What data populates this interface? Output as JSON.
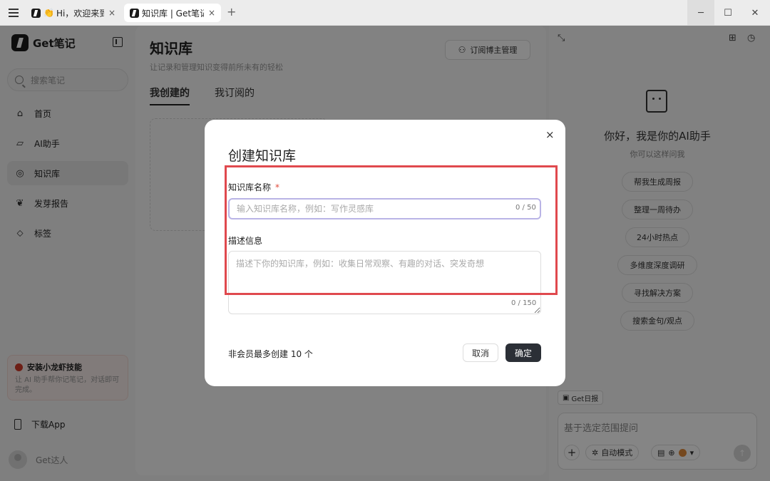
{
  "tabs": [
    {
      "emoji": "👏",
      "title": "Hi，欢迎来到Get笔记",
      "close": "×"
    },
    {
      "title": "知识库 | Get笔记",
      "close": "×"
    }
  ],
  "new_tab": "+",
  "window": {
    "minimize": "─",
    "maximize": "☐",
    "close": "✕"
  },
  "sidebar": {
    "logo_text": "Get笔记",
    "search_placeholder": "搜索笔记",
    "items": [
      {
        "icon": "⌂",
        "label": "首页"
      },
      {
        "icon": "▱",
        "label": "AI助手"
      },
      {
        "icon": "◎",
        "label": "知识库"
      },
      {
        "icon": "❦",
        "label": "发芽报告"
      },
      {
        "icon": "⬦",
        "label": "标签"
      }
    ],
    "promo_title": "安装小龙虾技能",
    "promo_desc": "让 AI 助手帮你记笔记，对话即可完成。",
    "download_label": "下载App",
    "user_name": "Get达人"
  },
  "main": {
    "title": "知识库",
    "subtitle": "让记录和管理知识变得前所未有的轻松",
    "subscribe_button": "订阅博主管理",
    "tabs": [
      "我创建的",
      "我订阅的"
    ]
  },
  "ai": {
    "greeting": "你好，我是你的AI助手",
    "hint": "你可以这样问我",
    "suggestions": [
      "帮我生成周报",
      "整理一周待办",
      "24小时热点",
      "多维度深度调研",
      "寻找解决方案",
      "搜索金句/观点"
    ],
    "daily_tag": "Get日报",
    "input_placeholder": "基于选定范围提问",
    "mode_label": "自动模式",
    "plus": "+",
    "send": "↑"
  },
  "modal": {
    "title": "创建知识库",
    "close": "×",
    "name_label": "知识库名称",
    "required_mark": "*",
    "name_placeholder": "输入知识库名称，例如：写作灵感库",
    "name_count": "0 / 50",
    "desc_label": "描述信息",
    "desc_placeholder": "描述下你的知识库，例如：收集日常观察、有趣的对话、突发奇想",
    "desc_count": "0 / 150",
    "member_note": "非会员最多创建 10 个",
    "cancel": "取消",
    "confirm": "确定"
  },
  "colors": {
    "highlight": "#e0494e",
    "primary_button": "#2b2f36",
    "focus_border": "#b9b4e6"
  }
}
